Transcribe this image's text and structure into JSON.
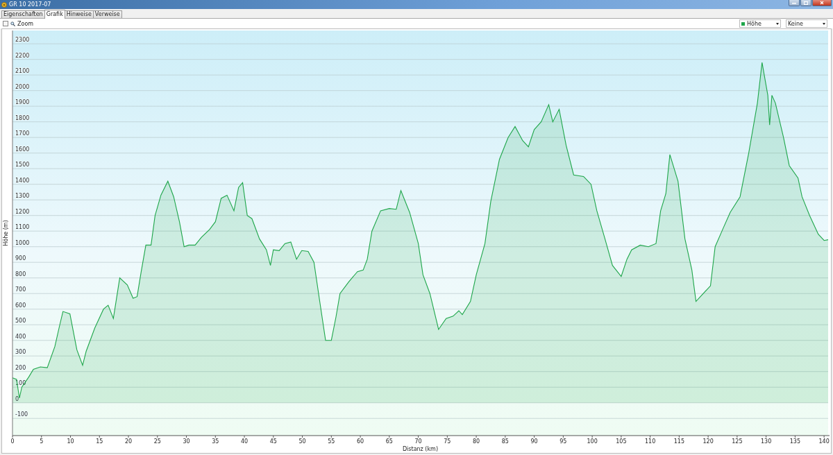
{
  "window": {
    "title": "GR 10 2017-07"
  },
  "tabs": [
    {
      "label": "Eigenschaften",
      "selected": false
    },
    {
      "label": "Grafik",
      "selected": true
    },
    {
      "label": "Hinweise",
      "selected": false
    },
    {
      "label": "Verweise",
      "selected": false
    }
  ],
  "toolbar": {
    "zoom": {
      "label": "Zoom",
      "checked": false
    },
    "compare_select": {
      "value": "Keine"
    }
  },
  "chart": {
    "chart_data": {
      "type": "area",
      "grid": true,
      "xlabel": "Distanz (km)",
      "ylabel": "Höhe (m)",
      "x": [
        0,
        0.7,
        1.2,
        1.6,
        2.8,
        3.6,
        4.8,
        6,
        7.3,
        8.1,
        8.7,
        9.9,
        11.1,
        12.1,
        12.7,
        14.2,
        15.7,
        16.5,
        17.4,
        18.5,
        19.8,
        20.8,
        21.5,
        22.2,
        23,
        23.9,
        24.6,
        25.6,
        26.8,
        27.8,
        28.8,
        29.6,
        30.4,
        31.5,
        32.6,
        34,
        35,
        36,
        37,
        38.2,
        39,
        39.7,
        40.5,
        41.3,
        42.6,
        43.8,
        44.5,
        45,
        46,
        47,
        48,
        49,
        49.9,
        51,
        52,
        53,
        54,
        55,
        55.8,
        56.5,
        58,
        59.5,
        60.5,
        61.2,
        62,
        63.5,
        65,
        66.2,
        67,
        68.5,
        70,
        70.8,
        72,
        73.5,
        74.8,
        76,
        77,
        77.6,
        79,
        80,
        81.5,
        82.5,
        84,
        85.5,
        86.7,
        88,
        89,
        90,
        91.2,
        92.5,
        93.2,
        94.3,
        95.5,
        96.8,
        98.5,
        99.8,
        100.8,
        102.2,
        103.5,
        105,
        106,
        106.8,
        108.3,
        109.7,
        111,
        111.8,
        112.7,
        113.4,
        114.8,
        116,
        117.2,
        117.9,
        120.4,
        121.2,
        122.5,
        123.8,
        125.5,
        127,
        128.5,
        129.3,
        130.3,
        130.6,
        131,
        131.6,
        133,
        134,
        135.5,
        136.2,
        137.5,
        139,
        140,
        140.7
      ],
      "series": [
        {
          "name": "Höhe",
          "color": "#1ea64a",
          "values": [
            160,
            150,
            30,
            100,
            165,
            215,
            230,
            225,
            360,
            490,
            585,
            570,
            340,
            240,
            330,
            480,
            600,
            625,
            540,
            800,
            755,
            670,
            680,
            840,
            1010,
            1010,
            1200,
            1330,
            1420,
            1320,
            1160,
            1000,
            1010,
            1010,
            1060,
            1110,
            1160,
            1310,
            1330,
            1230,
            1380,
            1410,
            1200,
            1180,
            1050,
            980,
            880,
            980,
            975,
            1020,
            1030,
            920,
            975,
            970,
            900,
            650,
            400,
            400,
            550,
            700,
            775,
            840,
            850,
            920,
            1100,
            1230,
            1245,
            1240,
            1360,
            1220,
            1020,
            820,
            700,
            470,
            540,
            555,
            590,
            565,
            650,
            820,
            1020,
            1290,
            1560,
            1700,
            1770,
            1680,
            1640,
            1750,
            1800,
            1910,
            1800,
            1880,
            1650,
            1460,
            1450,
            1400,
            1230,
            1050,
            880,
            810,
            920,
            980,
            1010,
            1000,
            1020,
            1230,
            1340,
            1590,
            1420,
            1050,
            850,
            650,
            750,
            1000,
            1110,
            1220,
            1320,
            1600,
            1920,
            2180,
            1970,
            1780,
            1970,
            1920,
            1700,
            1520,
            1440,
            1320,
            1200,
            1080,
            1040,
            1045
          ]
        }
      ],
      "xlim": [
        0,
        140.7
      ],
      "ylim": [
        -210,
        2385
      ],
      "xticks": [
        0,
        5,
        10,
        15,
        20,
        25,
        30,
        35,
        40,
        45,
        50,
        55,
        60,
        65,
        70,
        75,
        80,
        85,
        90,
        95,
        100,
        105,
        110,
        115,
        120,
        125,
        130,
        135,
        140
      ],
      "yticks": [
        -100,
        0,
        100,
        200,
        300,
        400,
        500,
        600,
        700,
        800,
        900,
        1000,
        1100,
        1200,
        1300,
        1400,
        1500,
        1600,
        1700,
        1800,
        1900,
        2000,
        2100,
        2200,
        2300
      ]
    }
  }
}
